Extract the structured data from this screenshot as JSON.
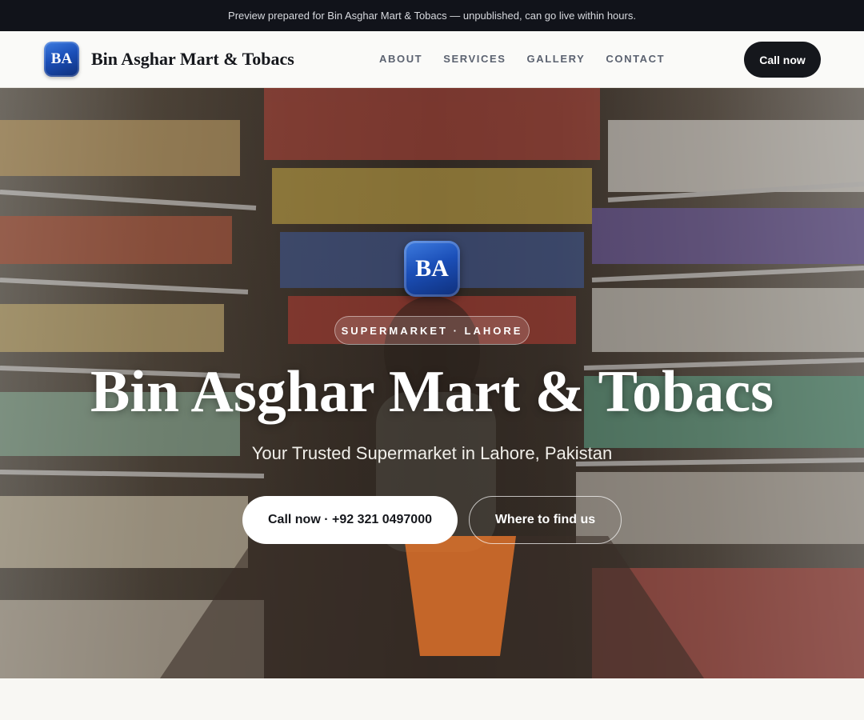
{
  "preview_banner": "Preview prepared for Bin Asghar Mart & Tobacs — unpublished, can go live within hours.",
  "header": {
    "logo_initials": "BA",
    "brand_name": "Bin Asghar Mart & Tobacs",
    "nav_links": [
      "ABOUT",
      "SERVICES",
      "GALLERY",
      "CONTACT"
    ],
    "cta_label": "Call now"
  },
  "hero": {
    "logo_initials": "BA",
    "badge": "SUPERMARKET · LAHORE",
    "title": "Bin Asghar Mart & Tobacs",
    "subtitle": "Your Trusted Supermarket in Lahore, Pakistan",
    "primary_button": "Call now · +92 321 0497000",
    "secondary_button": "Where to find us",
    "background_image": "supermarket aisle with shopper holding an orange basket"
  },
  "colors": {
    "dark": "#15171c",
    "logo_blue": "#1b4fb8",
    "page_background": "#f8f7f3"
  }
}
